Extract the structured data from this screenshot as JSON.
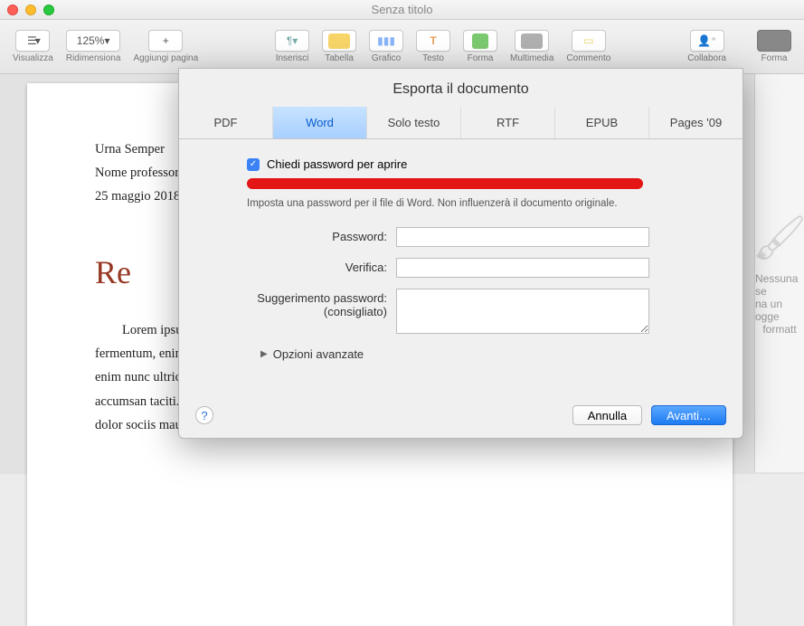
{
  "window": {
    "title": "Senza titolo"
  },
  "toolbar": {
    "visualizza": "Visualizza",
    "zoom": "125%",
    "ridimensiona": "Ridimensiona",
    "aggiungi_pagina": "Aggiungi pagina",
    "inserisci": "Inserisci",
    "tabella": "Tabella",
    "grafico": "Grafico",
    "testo": "Testo",
    "forma": "Forma",
    "multimedia": "Multimedia",
    "commento": "Commento",
    "collabora": "Collabora",
    "formato": "Forma"
  },
  "document": {
    "line1": "Urna Semper",
    "line2": "Nome professore",
    "line3": "25 maggio 2018",
    "heading": "Re",
    "para1_l1": "Lorem ipsu",
    "para1_l2": "fermentum, enim",
    "para1_l3": "enim nunc ultric",
    "para1_l4": "accumsan taciti.",
    "para1_l5": "dolor sociis mauris, vel eu libero cras. Faucibus at. Arcu habitasse elementum est, ipsum purus"
  },
  "inspector": {
    "line1": "Nessuna se",
    "line2": "na un ogge",
    "line3": "formatt"
  },
  "dialog": {
    "title": "Esporta il documento",
    "tabs": {
      "pdf": "PDF",
      "word": "Word",
      "solo_testo": "Solo testo",
      "rtf": "RTF",
      "epub": "EPUB",
      "pages09": "Pages '09"
    },
    "checkbox_label": "Chiedi password per aprire",
    "help_text": "Imposta una password per il file di Word. Non influenzerà il documento originale.",
    "password_label": "Password:",
    "verify_label": "Verifica:",
    "hint_label_l1": "Suggerimento password:",
    "hint_label_l2": "(consigliato)",
    "advanced": "Opzioni avanzate",
    "cancel": "Annulla",
    "next": "Avanti…"
  }
}
